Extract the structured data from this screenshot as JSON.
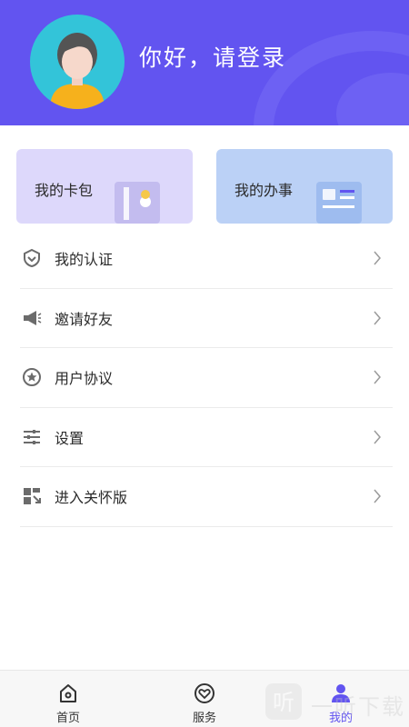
{
  "header": {
    "greeting": "你好，请登录",
    "background_color": "#6254f0"
  },
  "cards": [
    {
      "label": "我的卡包",
      "icon": "wallet-card-icon"
    },
    {
      "label": "我的办事",
      "icon": "affairs-document-icon"
    }
  ],
  "menu": {
    "items": [
      {
        "label": "我的认证",
        "icon": "verified-shield-icon"
      },
      {
        "label": "邀请好友",
        "icon": "megaphone-icon"
      },
      {
        "label": "用户协议",
        "icon": "star-badge-icon"
      },
      {
        "label": "设置",
        "icon": "sliders-icon"
      },
      {
        "label": "进入关怀版",
        "icon": "scan-expand-icon"
      }
    ]
  },
  "tabbar": {
    "tabs": [
      {
        "label": "首页",
        "icon": "home-icon",
        "active": false
      },
      {
        "label": "服务",
        "icon": "heart-service-icon",
        "active": false
      },
      {
        "label": "我的",
        "icon": "user-icon",
        "active": true
      }
    ],
    "active_color": "#6254f0"
  },
  "watermark": {
    "text": "一听下载",
    "icon": "ting-logo-icon"
  }
}
